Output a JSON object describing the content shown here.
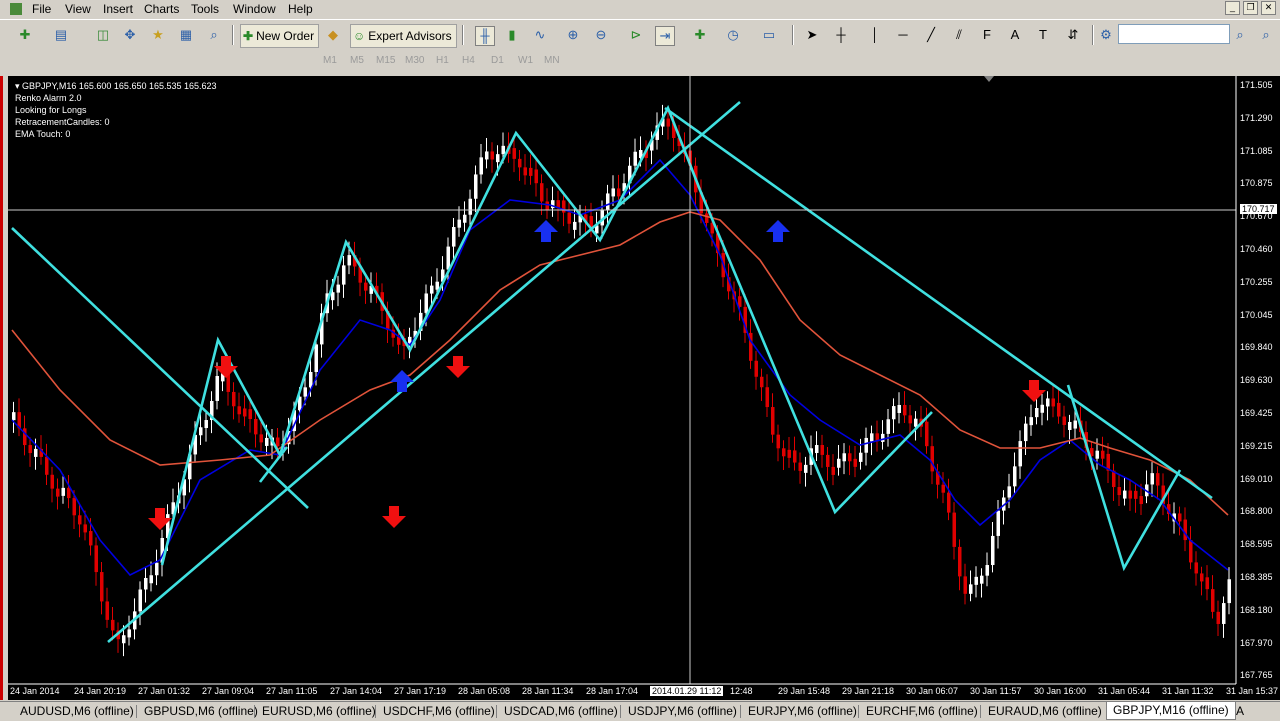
{
  "menu": {
    "items": [
      "File",
      "View",
      "Insert",
      "Charts",
      "Tools",
      "Window",
      "Help"
    ]
  },
  "toolbar": {
    "new_order": "New Order",
    "expert_advisors": "Expert Advisors"
  },
  "timeframes": [
    "M1",
    "M5",
    "M15",
    "M30",
    "H1",
    "H4",
    "D1",
    "W1",
    "MN"
  ],
  "chart": {
    "header": "GBPJPY,M16  165.600 165.650 165.535 165.623",
    "indicator_lines": [
      "Renko Alarm 2.0",
      "Looking for Longs",
      "RetracementCandles: 0",
      "EMA Touch: 0"
    ],
    "crosshair_price": "170.717",
    "crosshair_time": "2014.01.29 11:12",
    "price_axis": [
      "171.505",
      "171.290",
      "171.085",
      "170.875",
      "170.670",
      "170.460",
      "170.255",
      "170.045",
      "169.840",
      "169.630",
      "169.425",
      "169.215",
      "169.010",
      "168.800",
      "168.595",
      "168.385",
      "168.180",
      "167.970",
      "167.765"
    ],
    "time_axis": [
      "24 Jan 2014",
      "24 Jan 20:19",
      "27 Jan 01:32",
      "27 Jan 09:04",
      "27 Jan 11:05",
      "27 Jan 14:04",
      "27 Jan 17:19",
      "28 Jan 05:08",
      "28 Jan 11:34",
      "28 Jan 17:04",
      "2014.01.29 11:12",
      "12:48",
      "29 Jan 15:48",
      "29 Jan 21:18",
      "30 Jan 06:07",
      "30 Jan 11:57",
      "30 Jan 16:00",
      "31 Jan 05:44",
      "31 Jan 11:32",
      "31 Jan 15:37"
    ],
    "colors": {
      "bull": "#ffffff",
      "bear": "#e00000",
      "ema_fast": "#0000e0",
      "ema_slow": "#e0533a",
      "trend": "#40e0e0",
      "up_arrow": "#1830f0",
      "down_arrow": "#f01010"
    }
  },
  "symbol_tabs": [
    "AUDUSD,M6 (offline)",
    "GBPUSD,M6 (offline)",
    "EURUSD,M6 (offline)",
    "USDCHF,M6 (offline)",
    "USDCAD,M6 (offline)",
    "USDJPY,M6 (offline)",
    "EURJPY,M6 (offline)",
    "EURCHF,M6 (offline)",
    "EURAUD,M6 (offline)",
    "GBPJPY,M16 (offline)",
    "A"
  ]
}
